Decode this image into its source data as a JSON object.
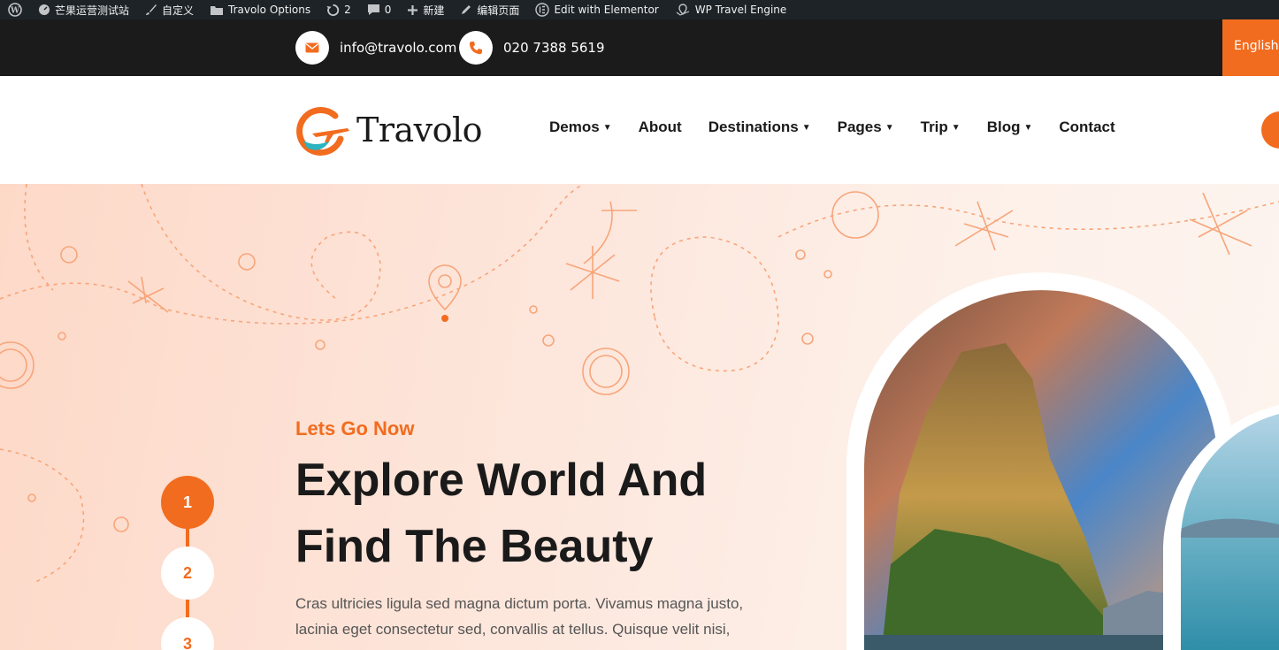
{
  "admin_bar": {
    "site_name": "芒果运营测试站",
    "customize": "自定义",
    "theme_options": "Travolo Options",
    "updates_count": "2",
    "comments_count": "0",
    "new": "新建",
    "edit_page": "编辑页面",
    "elementor": "Edit with Elementor",
    "travel_engine": "WP Travel Engine"
  },
  "topbar": {
    "email": "info@travolo.com",
    "phone": "020 7388 5619",
    "language": "English"
  },
  "header": {
    "logo_text": "Travolo",
    "nav": [
      {
        "label": "Demos",
        "has_dropdown": true
      },
      {
        "label": "About",
        "has_dropdown": false
      },
      {
        "label": "Destinations",
        "has_dropdown": true
      },
      {
        "label": "Pages",
        "has_dropdown": true
      },
      {
        "label": "Trip",
        "has_dropdown": true
      },
      {
        "label": "Blog",
        "has_dropdown": true
      },
      {
        "label": "Contact",
        "has_dropdown": false
      }
    ]
  },
  "hero": {
    "kicker": "Lets Go Now",
    "headline_line1": "Explore World And",
    "headline_line2": "Find The Beauty",
    "description_line1": "Cras ultricies ligula sed magna dictum porta. Vivamus magna justo,",
    "description_line2": "lacinia eget consectetur sed, convallis at tellus. Quisque velit nisi,",
    "steps": [
      "1",
      "2",
      "3"
    ],
    "active_step": "1"
  },
  "colors": {
    "accent": "#f26c1f",
    "dark": "#1b1b1b",
    "admin_bar": "#1d2327"
  }
}
